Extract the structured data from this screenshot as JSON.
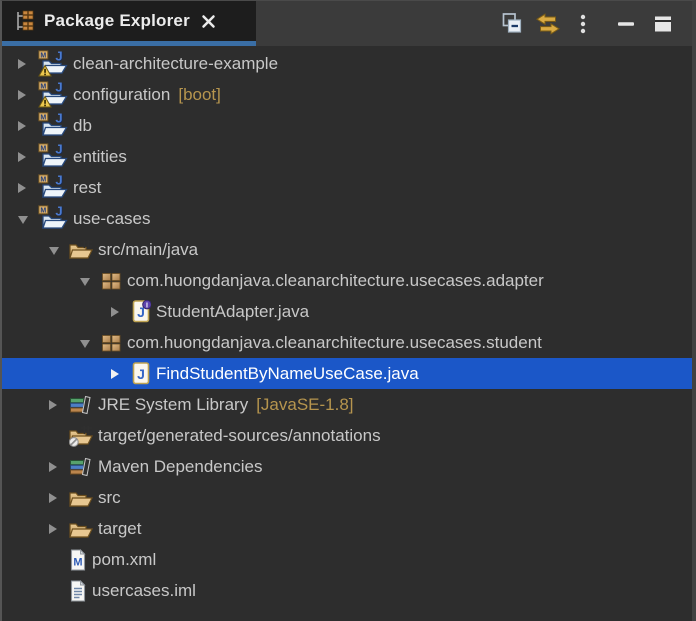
{
  "panel": {
    "tab": {
      "title": "Package Explorer",
      "icon": "package-explorer",
      "close_icon": "close"
    },
    "toolbar": [
      {
        "id": "collapse-all",
        "icon": "collapse-all",
        "tooltip": "Collapse All"
      },
      {
        "id": "link-with-editor",
        "icon": "link-with-editor",
        "tooltip": "Link with Editor"
      },
      {
        "id": "view-menu",
        "icon": "view-menu",
        "tooltip": "View Menu"
      },
      {
        "id": "minimize",
        "icon": "minimize",
        "tooltip": "Minimize"
      },
      {
        "id": "maximize",
        "icon": "maximize",
        "tooltip": "Maximize"
      }
    ]
  },
  "tree": {
    "items": [
      {
        "label": "clean-architecture-example",
        "decorator": "",
        "level": 0,
        "expand": "collapsed",
        "icon": "maven-project-warning",
        "selected": false
      },
      {
        "label": "configuration",
        "decorator": "[boot]",
        "level": 0,
        "expand": "collapsed",
        "icon": "maven-project-warning",
        "selected": false
      },
      {
        "label": "db",
        "decorator": "",
        "level": 0,
        "expand": "collapsed",
        "icon": "maven-project",
        "selected": false
      },
      {
        "label": "entities",
        "decorator": "",
        "level": 0,
        "expand": "collapsed",
        "icon": "maven-project",
        "selected": false
      },
      {
        "label": "rest",
        "decorator": "",
        "level": 0,
        "expand": "collapsed",
        "icon": "maven-project",
        "selected": false
      },
      {
        "label": "use-cases",
        "decorator": "",
        "level": 0,
        "expand": "expanded",
        "icon": "maven-project",
        "selected": false
      },
      {
        "label": "src/main/java",
        "decorator": "",
        "level": 1,
        "expand": "expanded",
        "icon": "source-folder",
        "selected": false
      },
      {
        "label": "com.huongdanjava.cleanarchitecture.usecases.adapter",
        "decorator": "",
        "level": 2,
        "expand": "expanded",
        "icon": "package",
        "selected": false
      },
      {
        "label": "StudentAdapter.java",
        "decorator": "",
        "level": 3,
        "expand": "collapsed",
        "icon": "java-interface-file",
        "selected": false
      },
      {
        "label": "com.huongdanjava.cleanarchitecture.usecases.student",
        "decorator": "",
        "level": 2,
        "expand": "expanded",
        "icon": "package",
        "selected": false
      },
      {
        "label": "FindStudentByNameUseCase.java",
        "decorator": "",
        "level": 3,
        "expand": "collapsed",
        "icon": "java-file",
        "selected": true
      },
      {
        "label": "JRE System Library",
        "decorator": "[JavaSE-1.8]",
        "level": 1,
        "expand": "collapsed",
        "icon": "library",
        "selected": false
      },
      {
        "label": "target/generated-sources/annotations",
        "decorator": "",
        "level": 1,
        "expand": "none",
        "icon": "excluded-source-folder",
        "selected": false
      },
      {
        "label": "Maven Dependencies",
        "decorator": "",
        "level": 1,
        "expand": "collapsed",
        "icon": "library",
        "selected": false
      },
      {
        "label": "src",
        "decorator": "",
        "level": 1,
        "expand": "collapsed",
        "icon": "folder",
        "selected": false
      },
      {
        "label": "target",
        "decorator": "",
        "level": 1,
        "expand": "collapsed",
        "icon": "folder",
        "selected": false
      },
      {
        "label": "pom.xml",
        "decorator": "",
        "level": 1,
        "expand": "none",
        "icon": "pom-file",
        "selected": false
      },
      {
        "label": "usercases.iml",
        "decorator": "",
        "level": 1,
        "expand": "none",
        "icon": "text-file",
        "selected": false
      }
    ]
  },
  "colors": {
    "selection": "#1b57c8",
    "decorator": "#b6954e",
    "tab_underline": "#3a6ea5",
    "tree_background": "#2d2d2d",
    "header_background": "#3b3b3b",
    "tab_background": "#1d1d1d",
    "text": "#c8c8c8"
  }
}
